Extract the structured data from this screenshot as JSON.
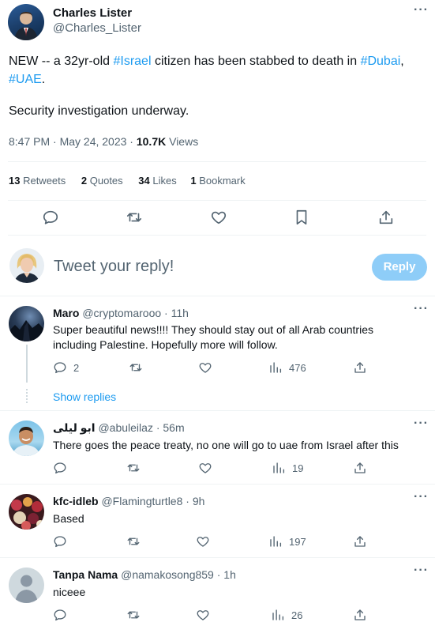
{
  "tweet": {
    "author_name": "Charles Lister",
    "author_handle": "@Charles_Lister",
    "text_1": "NEW -- a 32yr-old ",
    "hashtag_israel": "#Israel",
    "text_2": " citizen has been stabbed to death in ",
    "hashtag_dubai": "#Dubai",
    "text_3": ",",
    "hashtag_uae": "#UAE",
    "text_4": ".",
    "text_line2": "Security investigation underway.",
    "timestamp": "8:47 PM · May 24, 2023 · ",
    "views_count": "10.7K",
    "views_label": " Views",
    "stats": {
      "retweets_count": "13",
      "retweets_label": " Retweets",
      "quotes_count": "2",
      "quotes_label": " Quotes",
      "likes_count": "34",
      "likes_label": " Likes",
      "bookmarks_count": "1",
      "bookmarks_label": " Bookmark"
    }
  },
  "composer": {
    "placeholder": "Tweet your reply!",
    "button_label": "Reply"
  },
  "replies": [
    {
      "name": "Maro",
      "handle": "@cryptomarooo · 11h",
      "text": "Super beautiful news!!!! They should stay out of all Arab countries including Palestine. Hopefully more will follow.",
      "reply_count": "2",
      "retweet_count": "",
      "like_count": "",
      "views": "476",
      "show_replies": "Show replies"
    },
    {
      "name": "ابو ليلى",
      "handle": "@abuleilaz · 56m",
      "text": "There goes the peace treaty, no one will go to uae from Israel after this",
      "reply_count": "",
      "retweet_count": "",
      "like_count": "",
      "views": "19"
    },
    {
      "name": "kfc-idleb",
      "handle": "@Flamingturtle8 · 9h",
      "text": "Based",
      "reply_count": "",
      "retweet_count": "",
      "like_count": "",
      "views": "197"
    },
    {
      "name": "Tanpa Nama",
      "handle": "@namakosong859 · 1h",
      "text": "niceee",
      "reply_count": "",
      "retweet_count": "",
      "like_count": "",
      "views": "26"
    }
  ],
  "colors": {
    "accent": "#1d9bf0",
    "reply_button": "#8ecdf8",
    "muted": "#536471",
    "divider": "#eff3f4"
  }
}
